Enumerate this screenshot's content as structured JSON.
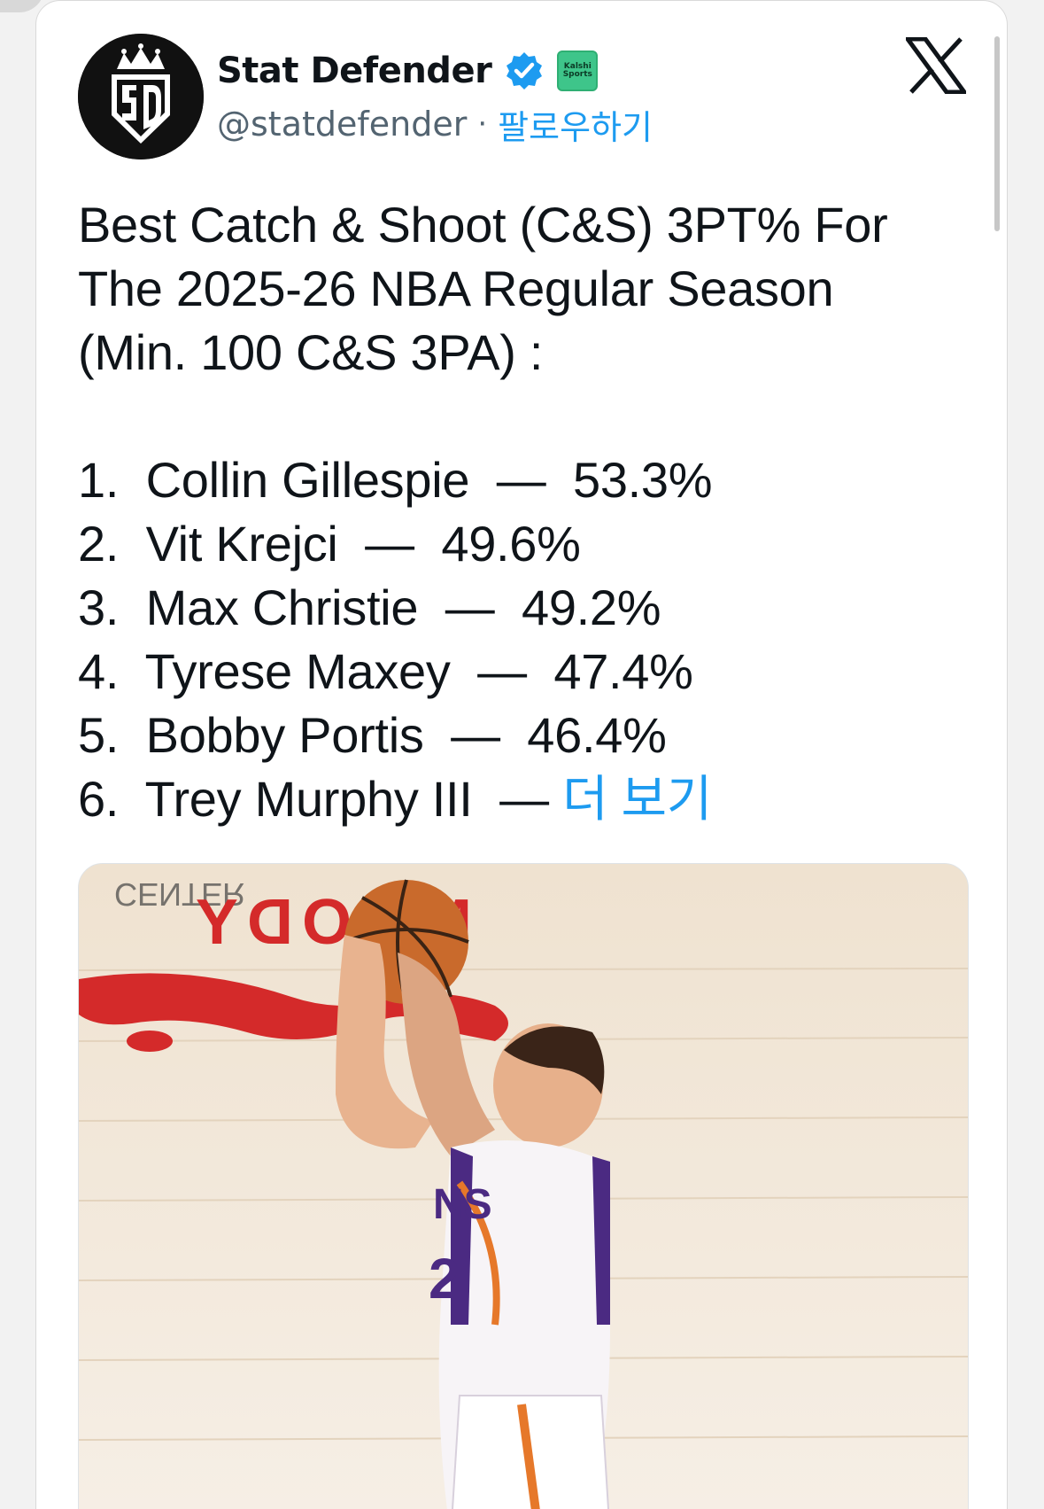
{
  "header": {
    "display_name": "Stat Defender",
    "handle": "@statdefender",
    "separator": "·",
    "follow_label": "팔로우하기",
    "avatar_icon": "stat-defender-logo",
    "avatar_text": "SD",
    "verified_icon": "verified-badge-icon",
    "affiliate_badge": [
      "Kalshi",
      "Sports"
    ],
    "platform_icon": "x-logo-icon"
  },
  "tweet": {
    "title_lines": [
      "Best Catch & Shoot (C&S) 3PT% For",
      "The 2025-26 NBA Regular Season",
      "(Min. 100 C&S 3PA) :"
    ],
    "rankings": [
      {
        "rank": "1.",
        "player": "Collin Gillespie",
        "dash": "—",
        "value": "53.3%"
      },
      {
        "rank": "2.",
        "player": "Vit Krejci",
        "dash": "—",
        "value": "49.6%"
      },
      {
        "rank": "3.",
        "player": "Max Christie",
        "dash": "—",
        "value": "49.2%"
      },
      {
        "rank": "4.",
        "player": "Tyrese Maxey",
        "dash": "—",
        "value": "47.4%"
      },
      {
        "rank": "5.",
        "player": "Bobby Portis",
        "dash": "—",
        "value": "46.4%"
      },
      {
        "rank": "6.",
        "player": "Trey Murphy III",
        "dash": "—",
        "value": ""
      }
    ],
    "more_label": "더 보기"
  },
  "media": {
    "description_icon": "player-shooting-photo",
    "court_text": "MOODY CENTER"
  },
  "colors": {
    "link": "#1d9bf0",
    "muted": "#536471",
    "text": "#0f1419",
    "verified": "#1d9bf0",
    "affiliate": "#3ec58a",
    "court_red": "#d42a2a"
  }
}
